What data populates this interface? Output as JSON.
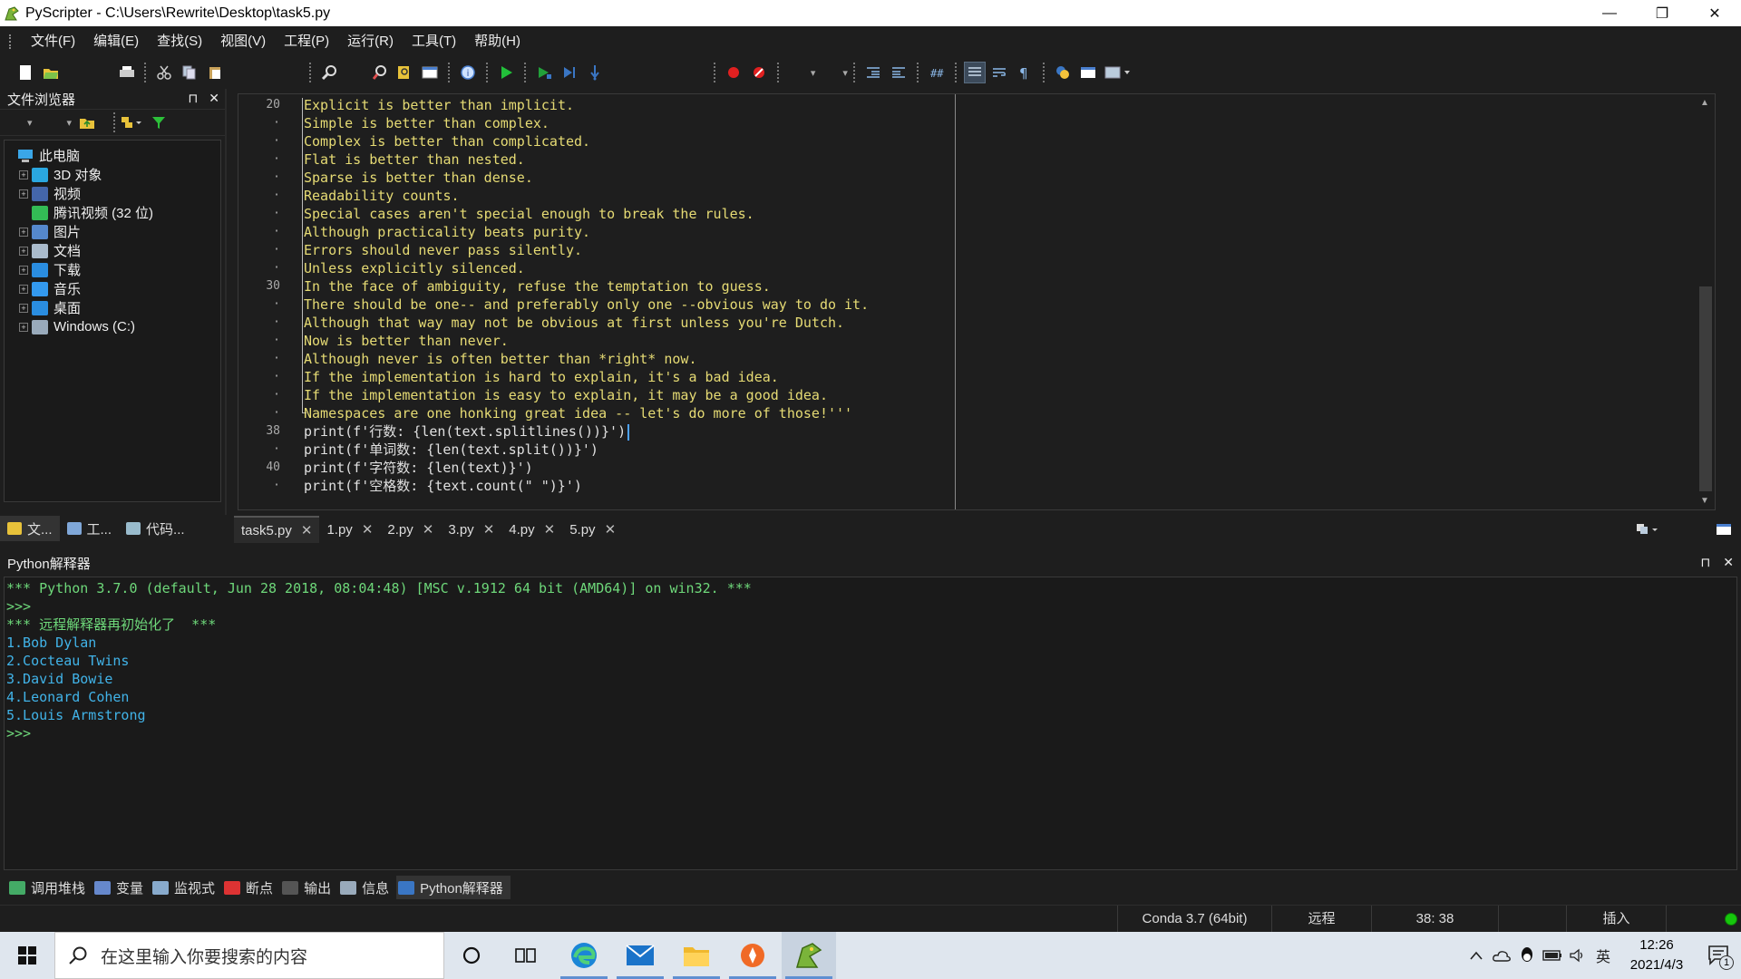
{
  "window": {
    "title": "PyScripter - C:\\Users\\Rewrite\\Desktop\\task5.py",
    "minimize": "—",
    "restore": "❐",
    "close": "✕"
  },
  "menu": [
    "文件(F)",
    "编辑(E)",
    "查找(S)",
    "视图(V)",
    "工程(P)",
    "运行(R)",
    "工具(T)",
    "帮助(H)"
  ],
  "file_browser": {
    "title": "文件浏览器",
    "pin": "⊓",
    "close": "✕",
    "root": "此电脑",
    "items": [
      {
        "label": "3D 对象",
        "color": "#2aa7e0",
        "expandable": true
      },
      {
        "label": "视频",
        "color": "#4466aa",
        "expandable": true
      },
      {
        "label": "腾讯视频 (32 位)",
        "color": "#33bb55",
        "expandable": false
      },
      {
        "label": "图片",
        "color": "#5588cc",
        "expandable": true
      },
      {
        "label": "文档",
        "color": "#aabbcc",
        "expandable": true
      },
      {
        "label": "下载",
        "color": "#2a8de0",
        "expandable": true
      },
      {
        "label": "音乐",
        "color": "#3399ee",
        "expandable": true
      },
      {
        "label": "桌面",
        "color": "#2a8de0",
        "expandable": true
      },
      {
        "label": "Windows (C:)",
        "color": "#99aabb",
        "expandable": true
      }
    ]
  },
  "left_tabs": [
    "文...",
    "工...",
    "代码..."
  ],
  "editor": {
    "gutter": [
      "20",
      "·",
      "·",
      "·",
      "·",
      "·",
      "·",
      "·",
      "·",
      "·",
      "30",
      "·",
      "·",
      "·",
      "·",
      "·",
      "·",
      "·",
      "38",
      "·",
      "40",
      "·"
    ],
    "lines": [
      "Explicit is better than implicit.",
      "Simple is better than complex.",
      "Complex is better than complicated.",
      "Flat is better than nested.",
      "Sparse is better than dense.",
      "Readability counts.",
      "Special cases aren't special enough to break the rules.",
      "Although practicality beats purity.",
      "Errors should never pass silently.",
      "Unless explicitly silenced.",
      "In the face of ambiguity, refuse the temptation to guess.",
      "There should be one-- and preferably only one --obvious way to do it.",
      "Although that way may not be obvious at first unless you're Dutch.",
      "Now is better than never.",
      "Although never is often better than *right* now.",
      "If the implementation is hard to explain, it's a bad idea.",
      "If the implementation is easy to explain, it may be a good idea.",
      "Namespaces are one honking great idea -- let's do more of those!'''",
      "print(f'行数: {len(text.splitlines())}')",
      "print(f'单词数: {len(text.split())}')",
      "print(f'字符数: {len(text)}')",
      "print(f'空格数: {text.count(\" \")}')"
    ]
  },
  "editor_tabs": [
    {
      "label": "task5.py",
      "active": true
    },
    {
      "label": "1.py",
      "active": false
    },
    {
      "label": "2.py",
      "active": false
    },
    {
      "label": "3.py",
      "active": false
    },
    {
      "label": "4.py",
      "active": false
    },
    {
      "label": "5.py",
      "active": false
    }
  ],
  "tab_close": "✕",
  "interpreter": {
    "title": "Python解释器",
    "pin": "⊓",
    "close": "✕",
    "lines": [
      {
        "text": "*** Python 3.7.0 (default, Jun 28 2018, 08:04:48) [MSC v.1912 64 bit (AMD64)] on win32. ***",
        "kind": "green"
      },
      {
        "text": ">>>",
        "kind": "green"
      },
      {
        "text": "*** 远程解释器再初始化了  ***",
        "kind": "green"
      },
      {
        "text": "1.Bob Dylan",
        "kind": "blue"
      },
      {
        "text": "2.Cocteau Twins",
        "kind": "blue"
      },
      {
        "text": "3.David Bowie",
        "kind": "blue"
      },
      {
        "text": "4.Leonard Cohen",
        "kind": "blue"
      },
      {
        "text": "5.Louis Armstrong",
        "kind": "blue"
      },
      {
        "text": ">>>",
        "kind": "green"
      }
    ]
  },
  "bottom_tabs": [
    {
      "label": "调用堆栈",
      "color": "#44aa66",
      "active": false
    },
    {
      "label": "变量",
      "color": "#6688cc",
      "active": false
    },
    {
      "label": "监视式",
      "color": "#88aacc",
      "active": false
    },
    {
      "label": "断点",
      "color": "#dd3333",
      "active": false
    },
    {
      "label": "输出",
      "color": "#555555",
      "active": false
    },
    {
      "label": "信息",
      "color": "#99aabb",
      "active": false
    },
    {
      "label": "Python解释器",
      "color": "#3a76c4",
      "active": true
    }
  ],
  "status": {
    "engine": "Conda 3.7 (64bit)",
    "mode": "远程",
    "position": "38: 38",
    "insert": "插入"
  },
  "taskbar": {
    "search_placeholder": "在这里输入你要搜索的内容",
    "ime": "英",
    "time": "12:26",
    "date": "2021/4/3",
    "notification_count": "1"
  }
}
